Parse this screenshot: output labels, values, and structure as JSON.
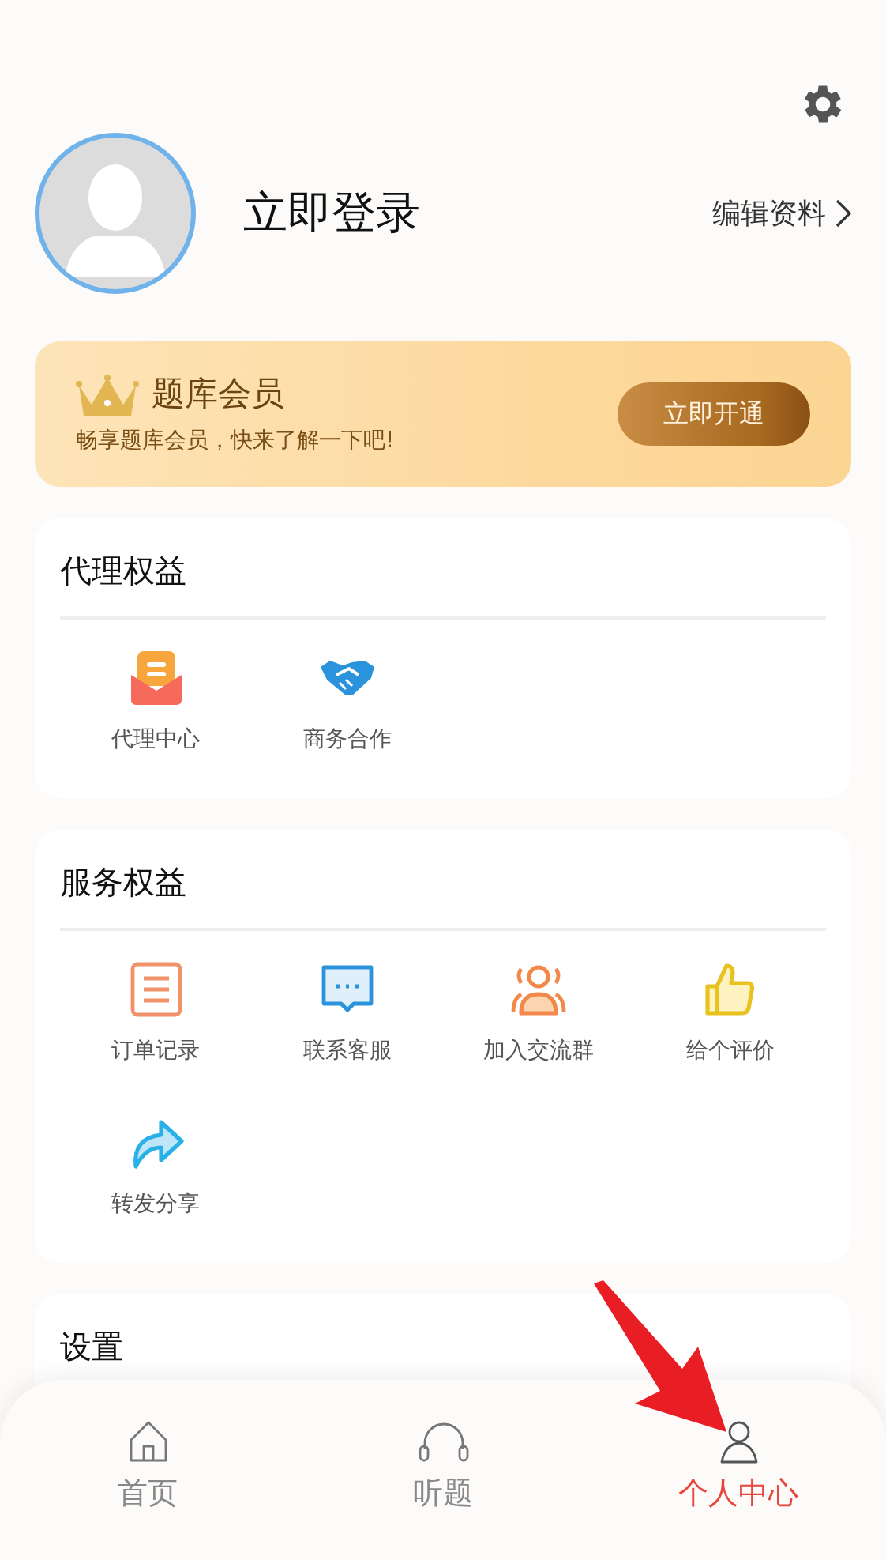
{
  "profile": {
    "login_text": "立即登录",
    "edit_link": "编辑资料"
  },
  "membership": {
    "title": "题库会员",
    "subtitle": "畅享题库会员，快来了解一下吧!",
    "button": "立即开通"
  },
  "sections": [
    {
      "title": "代理权益",
      "items": [
        {
          "label": "代理中心"
        },
        {
          "label": "商务合作"
        }
      ]
    },
    {
      "title": "服务权益",
      "items": [
        {
          "label": "订单记录"
        },
        {
          "label": "联系客服"
        },
        {
          "label": "加入交流群"
        },
        {
          "label": "给个评价"
        },
        {
          "label": "转发分享"
        }
      ]
    },
    {
      "title": "设置"
    }
  ],
  "bottom_nav": [
    {
      "label": "首页",
      "selected": false
    },
    {
      "label": "听题",
      "selected": false
    },
    {
      "label": "个人中心",
      "selected": true
    }
  ]
}
